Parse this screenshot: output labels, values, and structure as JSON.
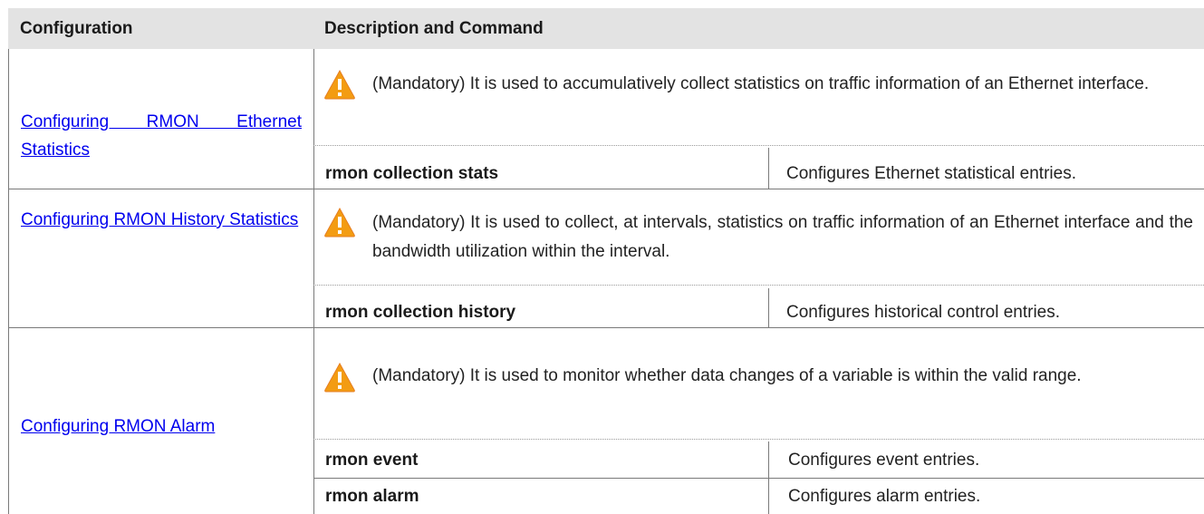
{
  "table": {
    "headers": {
      "configuration": "Configuration",
      "description": "Description and Command"
    },
    "rows": [
      {
        "config_link": "Configuring RMON Ethernet Statistics",
        "note": "(Mandatory) It is used to accumulatively collect statistics on traffic information of an Ethernet interface.",
        "commands": [
          {
            "command": "rmon collection stats",
            "description": "Configures Ethernet statistical entries."
          }
        ]
      },
      {
        "config_link": "Configuring RMON History Statistics",
        "note": "(Mandatory) It is used to collect, at intervals, statistics on traffic information of an Ethernet interface and the bandwidth utilization within the interval.",
        "commands": [
          {
            "command": "rmon collection history",
            "description": "Configures historical control entries."
          }
        ]
      },
      {
        "config_link": "Configuring RMON Alarm",
        "note": "(Mandatory) It is used to monitor whether data changes of a variable is within the valid range.",
        "commands": [
          {
            "command": "rmon event",
            "description": "Configures event entries."
          },
          {
            "command": "rmon alarm",
            "description": "Configures alarm entries."
          }
        ]
      }
    ]
  },
  "icons": {
    "warning": "warning-icon"
  },
  "colors": {
    "header_bg": "#e3e3e3",
    "link": "#0000ee",
    "warning_fill": "#f39c12"
  }
}
